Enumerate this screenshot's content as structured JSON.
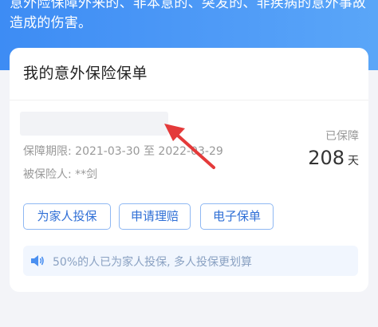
{
  "header": {
    "notice": "意外险保障外来的、非本意的、突发的、非疾病的意外事故造成的伤害。"
  },
  "card": {
    "title": "我的意外保险保单",
    "period_label": "保障期限: 2021-03-30 至 2022-03-29",
    "insured_label": "被保险人: **剑",
    "protected_label": "已保障",
    "protected_days": "208",
    "protected_unit": "天",
    "buttons": {
      "insure_family": "为家人投保",
      "claim": "申请理赔",
      "e_policy": "电子保单"
    },
    "tip": {
      "icon": "speaker-icon",
      "text": "50%的人已为家人投保, 多人投保更划算"
    }
  },
  "annotation": {
    "arrow_color": "#e43a3a"
  },
  "colors": {
    "header_blue": "#4a96f6",
    "button_text": "#2f6fd6",
    "tip_bg": "#f1f6fe"
  }
}
